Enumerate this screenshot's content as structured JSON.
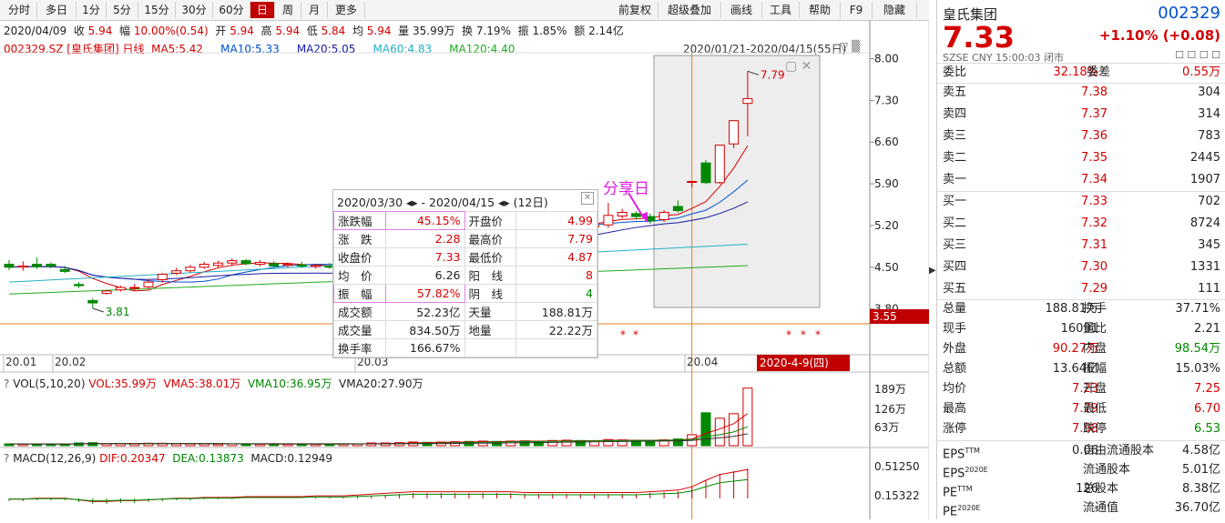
{
  "toolbar": {
    "left": [
      "分时",
      "多日",
      "1分",
      "5分",
      "15分",
      "30分",
      "60分",
      "日",
      "周",
      "月",
      "更多"
    ],
    "right": [
      "前复权",
      "超级叠加",
      "画线",
      "工具",
      "帮助",
      "F9",
      "隐藏"
    ]
  },
  "info_line": {
    "date": "2020/04/09",
    "close_label": "收",
    "close": "5.94",
    "change_label": "幅",
    "change": "10.00%(0.54)",
    "open_label": "开",
    "open": "5.94",
    "high_label": "高",
    "high": "5.94",
    "low_label": "低",
    "low": "5.84",
    "avg_label": "均",
    "avg": "5.94",
    "volume_label": "量",
    "volume": "35.99万",
    "turnover_label": "换",
    "turnover": "7.19%",
    "amplitude_label": "振",
    "amplitude": "1.85%",
    "amount_label": "额",
    "amount": "2.14亿"
  },
  "ma_line": {
    "code": "002329.SZ [皇氏集团] 日线",
    "ma5": "MA5:5.42",
    "ma10": "MA10:5.33",
    "ma20": "MA20:5.05",
    "ma60": "MA60:4.83",
    "ma120": "MA120:4.40",
    "range": "2020/01/21-2020/04/15(55日)"
  },
  "annotation": {
    "text": "分享日",
    "low_mark": "3.81",
    "high_mark": "7.79",
    "cross_price": "3.55",
    "cross_date": "2020-4-9(四)"
  },
  "colors": {
    "up": "#d40000",
    "down": "#008800",
    "ma5": "#d40000",
    "ma10": "#0050d0",
    "ma20": "#1a1aa0",
    "ma60": "#20b2c8",
    "ma120": "#22aa22",
    "annot": "#e020e0"
  },
  "price_axis": [
    "8.00",
    "7.30",
    "6.60",
    "5.90",
    "5.20",
    "4.50",
    "3.80"
  ],
  "date_axis": [
    "20.01",
    "20.02",
    "20.03",
    "20.04"
  ],
  "vol_line": {
    "q": "?",
    "name": "VOL(5,10,20)",
    "vol": "VOL:35.99万",
    "vma5": "VMA5:38.01万",
    "vma10": "VMA10:36.95万",
    "vma20": "VMA20:27.90万"
  },
  "vol_axis": [
    "189万",
    "126万",
    "63万"
  ],
  "macd_line": {
    "q": "?",
    "name": "MACD(12,26,9)",
    "dif": "DIF:0.20347",
    "dea": "DEA:0.13873",
    "macd": "MACD:0.12949"
  },
  "macd_axis": [
    "0.51250",
    "0.15322"
  ],
  "tooltip": {
    "range": "2020/03/30 ◂▸ - 2020/04/15 ◂▸ (12日)",
    "rows": [
      [
        "涨跌幅",
        "45.15%",
        "开盘价",
        "4.99"
      ],
      [
        "涨　跌",
        "2.28",
        "最高价",
        "7.79"
      ],
      [
        "收盘价",
        "7.33",
        "最低价",
        "4.87"
      ],
      [
        "均　价",
        "6.26",
        "阳　线",
        "8"
      ],
      [
        "振　幅",
        "57.82%",
        "阴　线",
        "4"
      ],
      [
        "成交额",
        "52.23亿",
        "天量",
        "188.81万"
      ],
      [
        "成交量",
        "834.50万",
        "地量",
        "22.22万"
      ],
      [
        "换手率",
        "166.67%",
        "",
        ""
      ]
    ]
  },
  "right_panel": {
    "name": "皇氏集团",
    "code": "002329",
    "price": "7.33",
    "change": "+1.10% (+0.08)",
    "market": "SZSE CNY 15:00:03 闭市",
    "weibi_label": "委比",
    "weibi": "32.18%",
    "weicha_label": "委差",
    "weicha": "0.55万",
    "asks": [
      [
        "卖五",
        "7.38",
        "304"
      ],
      [
        "卖四",
        "7.37",
        "314"
      ],
      [
        "卖三",
        "7.36",
        "783"
      ],
      [
        "卖二",
        "7.35",
        "2445"
      ],
      [
        "卖一",
        "7.34",
        "1907"
      ]
    ],
    "bids": [
      [
        "买一",
        "7.33",
        "702"
      ],
      [
        "买二",
        "7.32",
        "8724"
      ],
      [
        "买三",
        "7.31",
        "345"
      ],
      [
        "买四",
        "7.30",
        "1331"
      ],
      [
        "买五",
        "7.29",
        "111"
      ]
    ],
    "stats": [
      [
        "总量",
        "188.81万",
        "换手",
        "37.71%"
      ],
      [
        "现手",
        "16091",
        "量比",
        "2.21"
      ],
      [
        "外盘",
        "90.27万",
        "内盘",
        "98.54万"
      ],
      [
        "总额",
        "13.64亿",
        "振幅",
        "15.03%"
      ],
      [
        "均价",
        "7.23",
        "开盘",
        "7.25"
      ],
      [
        "最高",
        "7.79",
        "最低",
        "6.70"
      ],
      [
        "涨停",
        "7.98",
        "跌停",
        "6.53"
      ]
    ],
    "fin": [
      [
        "EPS",
        "TTM",
        "0.06",
        "自由流通股本",
        "4.58亿"
      ],
      [
        "EPS",
        "2020E",
        "",
        "流通股本",
        "5.01亿"
      ],
      [
        "PE",
        "TTM",
        "126",
        "总股本",
        "8.38亿"
      ],
      [
        "PE",
        "2020E",
        "-",
        "流通值",
        "36.70亿"
      ]
    ]
  },
  "chart_data": {
    "type": "candlestick",
    "candles": [
      [
        4.55,
        4.5,
        4.62,
        4.45
      ],
      [
        4.5,
        4.52,
        4.6,
        4.44
      ],
      [
        4.55,
        4.51,
        4.66,
        4.47
      ],
      [
        4.55,
        4.52,
        4.58,
        4.48
      ],
      [
        4.46,
        4.43,
        4.52,
        4.4
      ],
      [
        4.21,
        4.19,
        4.25,
        4.15
      ],
      [
        3.94,
        3.9,
        3.98,
        3.81
      ],
      [
        4.06,
        4.1,
        4.12,
        4.04
      ],
      [
        4.12,
        4.16,
        4.19,
        4.09
      ],
      [
        4.15,
        4.16,
        4.22,
        4.11
      ],
      [
        4.17,
        4.25,
        4.3,
        4.14
      ],
      [
        4.29,
        4.38,
        4.4,
        4.24
      ],
      [
        4.4,
        4.44,
        4.49,
        4.37
      ],
      [
        4.44,
        4.5,
        4.54,
        4.41
      ],
      [
        4.5,
        4.55,
        4.59,
        4.47
      ],
      [
        4.53,
        4.57,
        4.61,
        4.49
      ],
      [
        4.57,
        4.61,
        4.65,
        4.52
      ],
      [
        4.61,
        4.56,
        4.64,
        4.53
      ],
      [
        4.55,
        4.58,
        4.62,
        4.51
      ],
      [
        4.56,
        4.52,
        4.6,
        4.49
      ],
      [
        4.53,
        4.55,
        4.58,
        4.5
      ],
      [
        4.54,
        4.52,
        4.59,
        4.49
      ],
      [
        4.51,
        4.53,
        4.56,
        4.48
      ],
      [
        4.52,
        4.5,
        4.57,
        4.47
      ],
      [
        4.5,
        4.52,
        4.55,
        4.47
      ],
      [
        4.52,
        4.55,
        4.59,
        4.49
      ],
      [
        4.56,
        4.7,
        4.77,
        4.54
      ],
      [
        4.72,
        4.8,
        4.84,
        4.68
      ],
      [
        4.95,
        5.05,
        5.1,
        4.9
      ],
      [
        5.1,
        5.15,
        5.18,
        5.04
      ],
      [
        5.1,
        5.05,
        5.16,
        5.02
      ],
      [
        5.05,
        5.12,
        5.16,
        5.0
      ],
      [
        5.12,
        5.2,
        5.24,
        5.08
      ],
      [
        5.2,
        5.18,
        5.26,
        5.12
      ],
      [
        5.18,
        5.22,
        5.28,
        5.14
      ],
      [
        5.22,
        5.2,
        5.3,
        5.16
      ],
      [
        5.18,
        5.24,
        5.3,
        5.14
      ],
      [
        5.26,
        5.18,
        5.31,
        5.16
      ],
      [
        5.16,
        5.15,
        5.24,
        5.1
      ],
      [
        5.15,
        5.25,
        5.28,
        5.1
      ],
      [
        5.26,
        5.3,
        5.36,
        5.18
      ],
      [
        5.3,
        5.22,
        5.34,
        5.18
      ],
      [
        5.18,
        5.2,
        5.26,
        5.14
      ],
      [
        5.21,
        5.37,
        5.58,
        5.16
      ],
      [
        5.36,
        5.42,
        5.48,
        5.32
      ],
      [
        5.4,
        5.35,
        5.44,
        5.3
      ],
      [
        5.35,
        5.28,
        5.4,
        5.23
      ],
      [
        5.3,
        5.42,
        5.46,
        5.26
      ],
      [
        5.52,
        5.45,
        5.62,
        5.42
      ],
      [
        5.94,
        5.94,
        5.94,
        5.84
      ],
      [
        6.25,
        5.92,
        6.3,
        5.9
      ],
      [
        5.92,
        6.55,
        6.55,
        5.9
      ],
      [
        6.57,
        6.96,
        6.96,
        6.5
      ],
      [
        7.25,
        7.33,
        7.79,
        6.7
      ]
    ],
    "volume": [
      6,
      5,
      6,
      5,
      5,
      9,
      10,
      6,
      7,
      6,
      8,
      8,
      7,
      6,
      6,
      5,
      6,
      6,
      5,
      5,
      5,
      6,
      5,
      5,
      6,
      6,
      9,
      9,
      10,
      12,
      11,
      12,
      13,
      14,
      15,
      14,
      15,
      16,
      15,
      17,
      18,
      17,
      16,
      20,
      19,
      17,
      16,
      19,
      22,
      36,
      108,
      90,
      105,
      189
    ],
    "macd": [
      -0.03,
      -0.03,
      -0.02,
      -0.02,
      -0.02,
      -0.04,
      -0.06,
      -0.06,
      -0.05,
      -0.05,
      -0.04,
      -0.03,
      -0.02,
      -0.02,
      -0.01,
      -0.01,
      -0.01,
      0.0,
      0.0,
      0.0,
      0.0,
      0.0,
      0.01,
      0.01,
      0.01,
      0.02,
      0.03,
      0.04,
      0.05,
      0.06,
      0.06,
      0.06,
      0.06,
      0.06,
      0.06,
      0.06,
      0.06,
      0.05,
      0.05,
      0.05,
      0.05,
      0.05,
      0.05,
      0.05,
      0.05,
      0.05,
      0.06,
      0.07,
      0.08,
      0.12,
      0.2,
      0.27,
      0.3,
      0.33
    ],
    "price_range": [
      3.55,
      8.1
    ]
  }
}
